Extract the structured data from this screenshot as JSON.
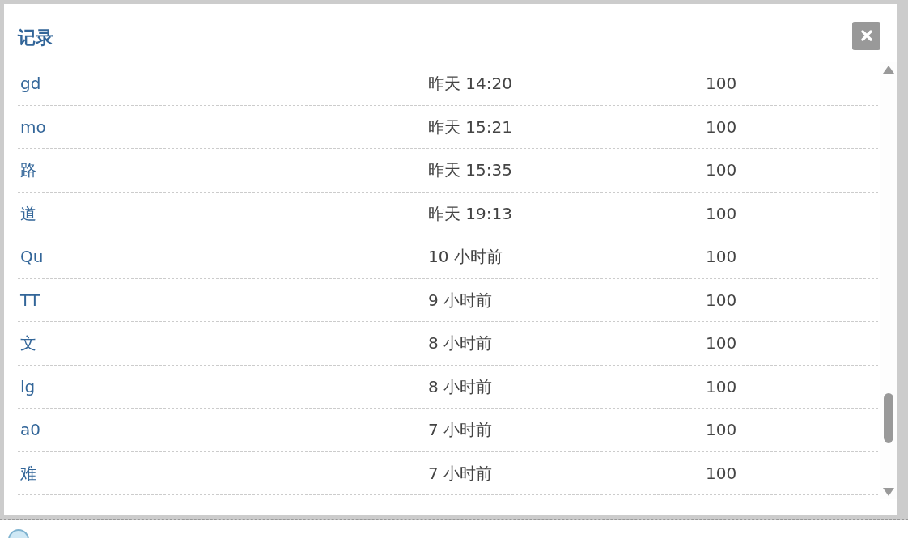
{
  "dialog": {
    "title": "记录",
    "rows": [
      {
        "name": "gd",
        "time": "昨天 14:20",
        "score": "100"
      },
      {
        "name": "mo",
        "time": "昨天 15:21",
        "score": "100"
      },
      {
        "name": "路",
        "time": "昨天 15:35",
        "score": "100"
      },
      {
        "name": "道",
        "time": "昨天 19:13",
        "score": "100"
      },
      {
        "name": "Qu",
        "time": "10 小时前",
        "score": "100"
      },
      {
        "name": "TT",
        "time": "9 小时前",
        "score": "100"
      },
      {
        "name": "文",
        "time": "8 小时前",
        "score": "100"
      },
      {
        "name": "lg",
        "time": "8 小时前",
        "score": "100"
      },
      {
        "name": "a0",
        "time": "7 小时前",
        "score": "100"
      },
      {
        "name": "难",
        "time": "7 小时前",
        "score": "100"
      }
    ]
  }
}
